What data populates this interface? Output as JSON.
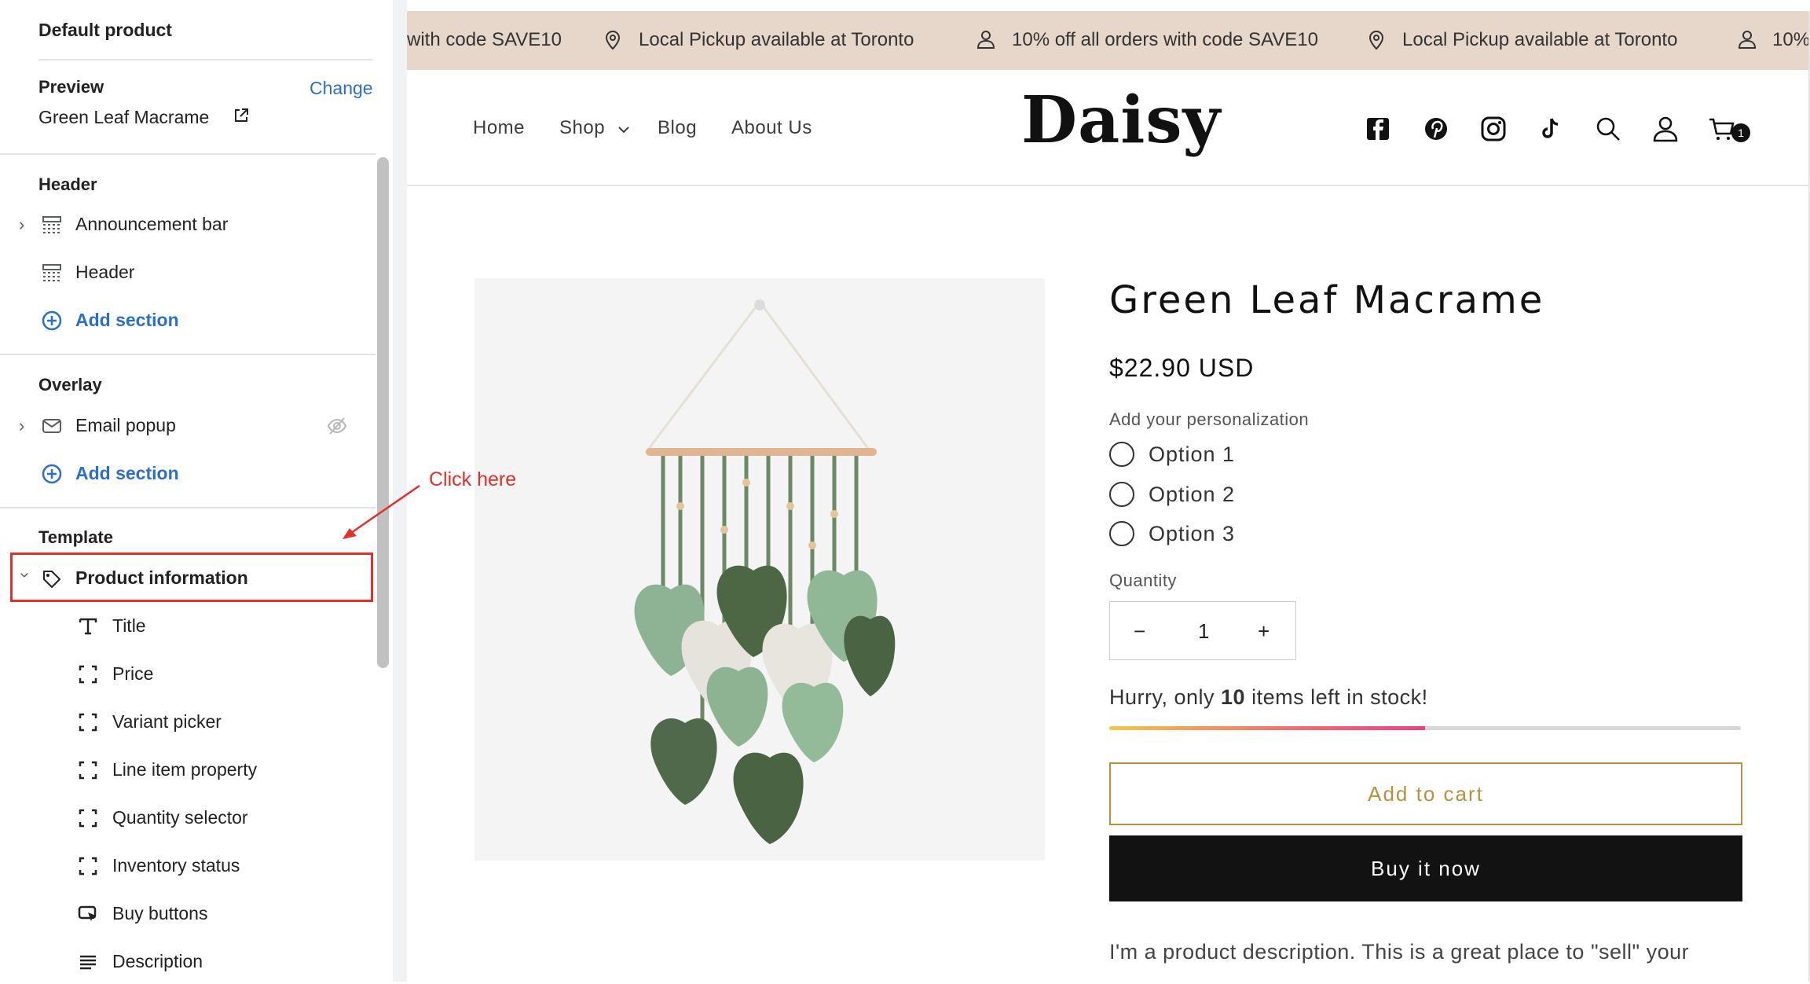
{
  "sidebar": {
    "title": "Default product",
    "preview_label": "Preview",
    "change_link": "Change",
    "preview_product": "Green Leaf Macrame",
    "groups": {
      "header": {
        "title": "Header",
        "items": [
          "Announcement bar",
          "Header"
        ],
        "add_section": "Add section"
      },
      "overlay": {
        "title": "Overlay",
        "items": [
          "Email popup"
        ],
        "add_section": "Add section"
      },
      "template": {
        "title": "Template",
        "section": "Product information",
        "blocks": [
          "Title",
          "Price",
          "Variant picker",
          "Line item property",
          "Quantity selector",
          "Inventory status",
          "Buy buttons",
          "Description"
        ]
      }
    }
  },
  "annotation": {
    "text": "Click here",
    "color": "#e3302a"
  },
  "store": {
    "announcements": [
      "with code SAVE10",
      "Local Pickup available at Toronto",
      "10% off all orders with code SAVE10",
      "Local Pickup available at Toronto",
      "10%"
    ],
    "nav": [
      "Home",
      "Shop",
      "Blog",
      "About Us"
    ],
    "logo": "Daisy",
    "header_icons": [
      "facebook-icon",
      "pinterest-icon",
      "instagram-icon",
      "tiktok-icon",
      "search-icon",
      "account-icon",
      "cart-icon"
    ],
    "cart_count": "1",
    "product": {
      "title": "Green Leaf Macrame",
      "price": "$22.90 USD",
      "personalization_label": "Add your personalization",
      "options": [
        "Option 1",
        "Option 2",
        "Option 3"
      ],
      "quantity_label": "Quantity",
      "quantity_value": "1",
      "quantity_minus": "−",
      "quantity_plus": "+",
      "stock_prefix": "Hurry, only ",
      "stock_count": "10",
      "stock_suffix": " items left in stock!",
      "stock_fraction": 0.5,
      "add_to_cart": "Add to cart",
      "buy_now": "Buy it now",
      "description": "I'm a product description. This is a great place to \"sell\" your"
    }
  },
  "colors": {
    "accent": "#2c6ecb",
    "announcement_bg": "#e7d7cb",
    "button_gold": "#b8923e",
    "button_dark": "#121212"
  }
}
